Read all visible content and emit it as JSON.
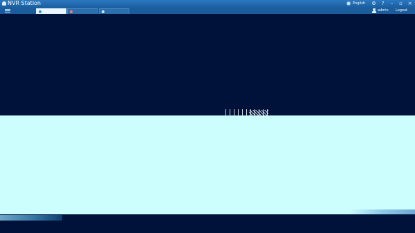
{
  "window": {
    "title": "NVR Station",
    "language": "English",
    "user": "admin",
    "logout": "Logout"
  },
  "icons": {
    "app": "monitor-icon",
    "language": "globe-icon",
    "settings": "gear-icon",
    "help": "help-icon",
    "minimize": "minimize-icon",
    "restore": "restore-icon",
    "close": "close-icon",
    "menu": "menu-icon",
    "user": "user-icon"
  },
  "tabs": [
    {
      "label": "",
      "state": "active"
    },
    {
      "label": "",
      "state": "inactive"
    },
    {
      "label": "",
      "state": "inactive"
    }
  ],
  "colors": {
    "titlebar": "#2a78c0",
    "toolbar": "#1a5c9c",
    "video_dark": "#00123a",
    "video_light": "#ccfefe"
  }
}
